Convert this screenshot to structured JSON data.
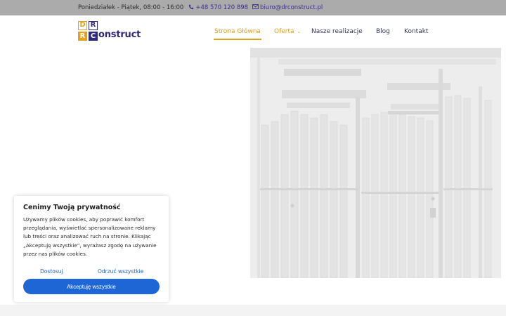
{
  "topbar": {
    "hours": "Poniedziałek - Piątek, 08:00 - 16:00",
    "phone": "+48 570 120 898",
    "email": "biuro@drconstruct.pl",
    "phone_icon": "phone-icon",
    "email_icon": "envelope-icon"
  },
  "logo": {
    "letters": [
      "D",
      "R",
      "R",
      "C"
    ],
    "word": "onstruct",
    "colors": {
      "orange": "#e6a11a",
      "navy": "#2d2a7a"
    }
  },
  "nav": {
    "items": [
      {
        "label": "Strona Główna",
        "active": true
      },
      {
        "label": "Oferta",
        "has_dropdown": true
      },
      {
        "label": "Nasze realizacje"
      },
      {
        "label": "Blog"
      },
      {
        "label": "Kontakt"
      }
    ],
    "accent": "#e0a020"
  },
  "cookie": {
    "title": "Cenimy Twoją prywatność",
    "text": "Używamy plików cookies, aby poprawić komfort przeglądania, wyświetlać spersonalizowane reklamy lub treści oraz analizować ruch na stronie. Klikając „Akceptuję wszystkie”, wyrażasz zgodę na używanie przez nas plików cookies.",
    "customize_label": "Dostosuj",
    "reject_label": "Odrzuć wszystkie",
    "accept_label": "Akceptuję wszystkie",
    "accent": "#1e66d6"
  }
}
